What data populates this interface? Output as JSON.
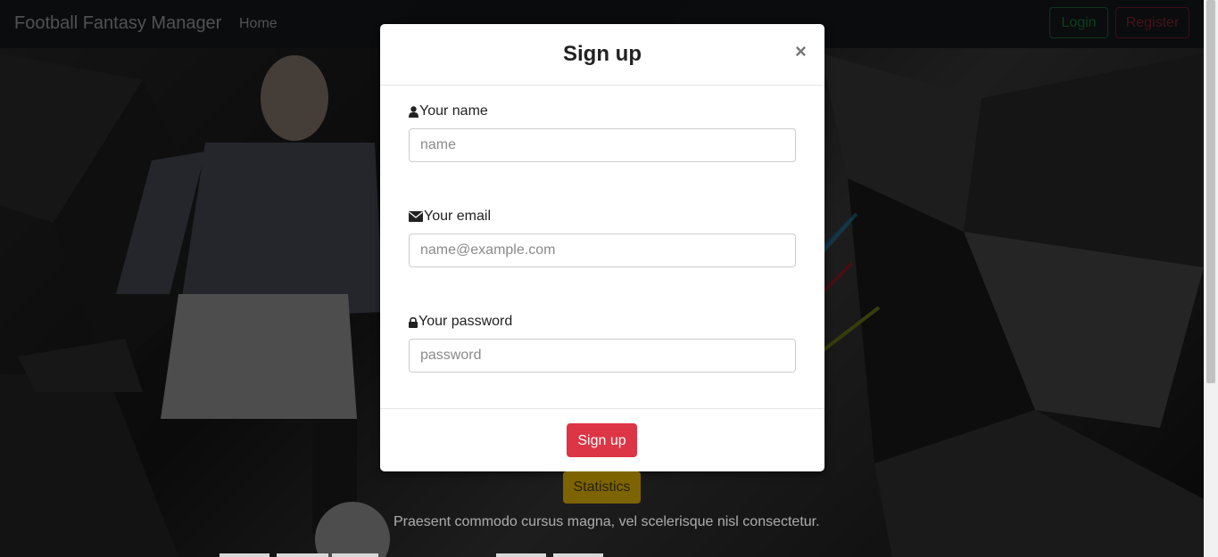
{
  "navbar": {
    "brand": "Football Fantasy Manager",
    "home_label": "Home",
    "login_label": "Login",
    "register_label": "Register"
  },
  "hero": {
    "statistics_label": "Statistics",
    "lead_text": "Praesent commodo cursus magna, vel scelerisque nisl consectetur."
  },
  "modal": {
    "title": "Sign up",
    "close_label": "×",
    "fields": [
      {
        "label": "Your name",
        "placeholder": "name",
        "icon": "user-icon"
      },
      {
        "label": "Your email",
        "placeholder": "name@example.com",
        "icon": "envelope-icon"
      },
      {
        "label": "Your password",
        "placeholder": "password",
        "icon": "lock-icon"
      }
    ],
    "submit_label": "Sign up"
  },
  "colors": {
    "signup_button": "#dc3545",
    "login_outline": "#28a745",
    "register_outline": "#dc3545",
    "statistics_button": "#ffc107"
  }
}
